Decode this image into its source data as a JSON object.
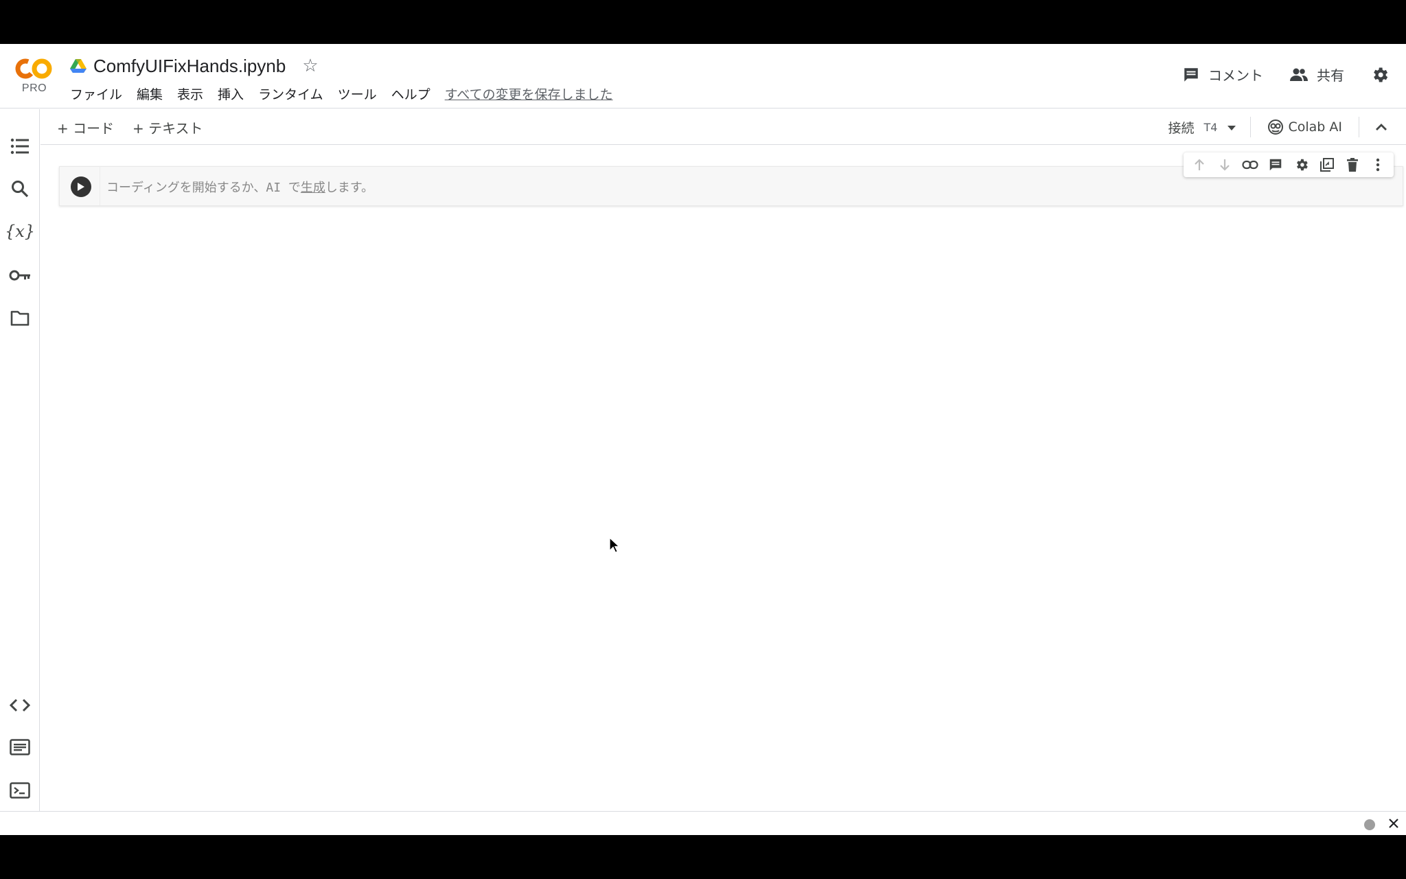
{
  "app": {
    "logo_text": "CO",
    "logo_badge": "PRO",
    "title": "ComfyUIFixHands.ipynb"
  },
  "menu": {
    "items": [
      "ファイル",
      "編集",
      "表示",
      "挿入",
      "ランタイム",
      "ツール",
      "ヘルプ"
    ],
    "save_status": "すべての変更を保存しました"
  },
  "header_actions": {
    "comment_label": "コメント",
    "share_label": "共有"
  },
  "toolbar": {
    "add_code_label": "+ コード",
    "add_text_label": "+ テキスト",
    "connect_label": "接続",
    "runtime_type": "T4",
    "colab_ai_label": "Colab AI"
  },
  "cell": {
    "placeholder_before": "コーディングを開始するか、AI で",
    "placeholder_link": "生成",
    "placeholder_after": "します。"
  },
  "sidebar": {
    "icons": [
      "table-of-contents-icon",
      "search-icon",
      "variables-icon",
      "secrets-key-icon",
      "files-folder-icon",
      "code-snippets-icon",
      "command-palette-icon",
      "terminal-icon"
    ]
  },
  "colors": {
    "logo_orange": "#F9AB00",
    "logo_dark_orange": "#E8710A",
    "text_primary": "#202124",
    "text_secondary": "#5f6368",
    "border": "#dadce0"
  }
}
